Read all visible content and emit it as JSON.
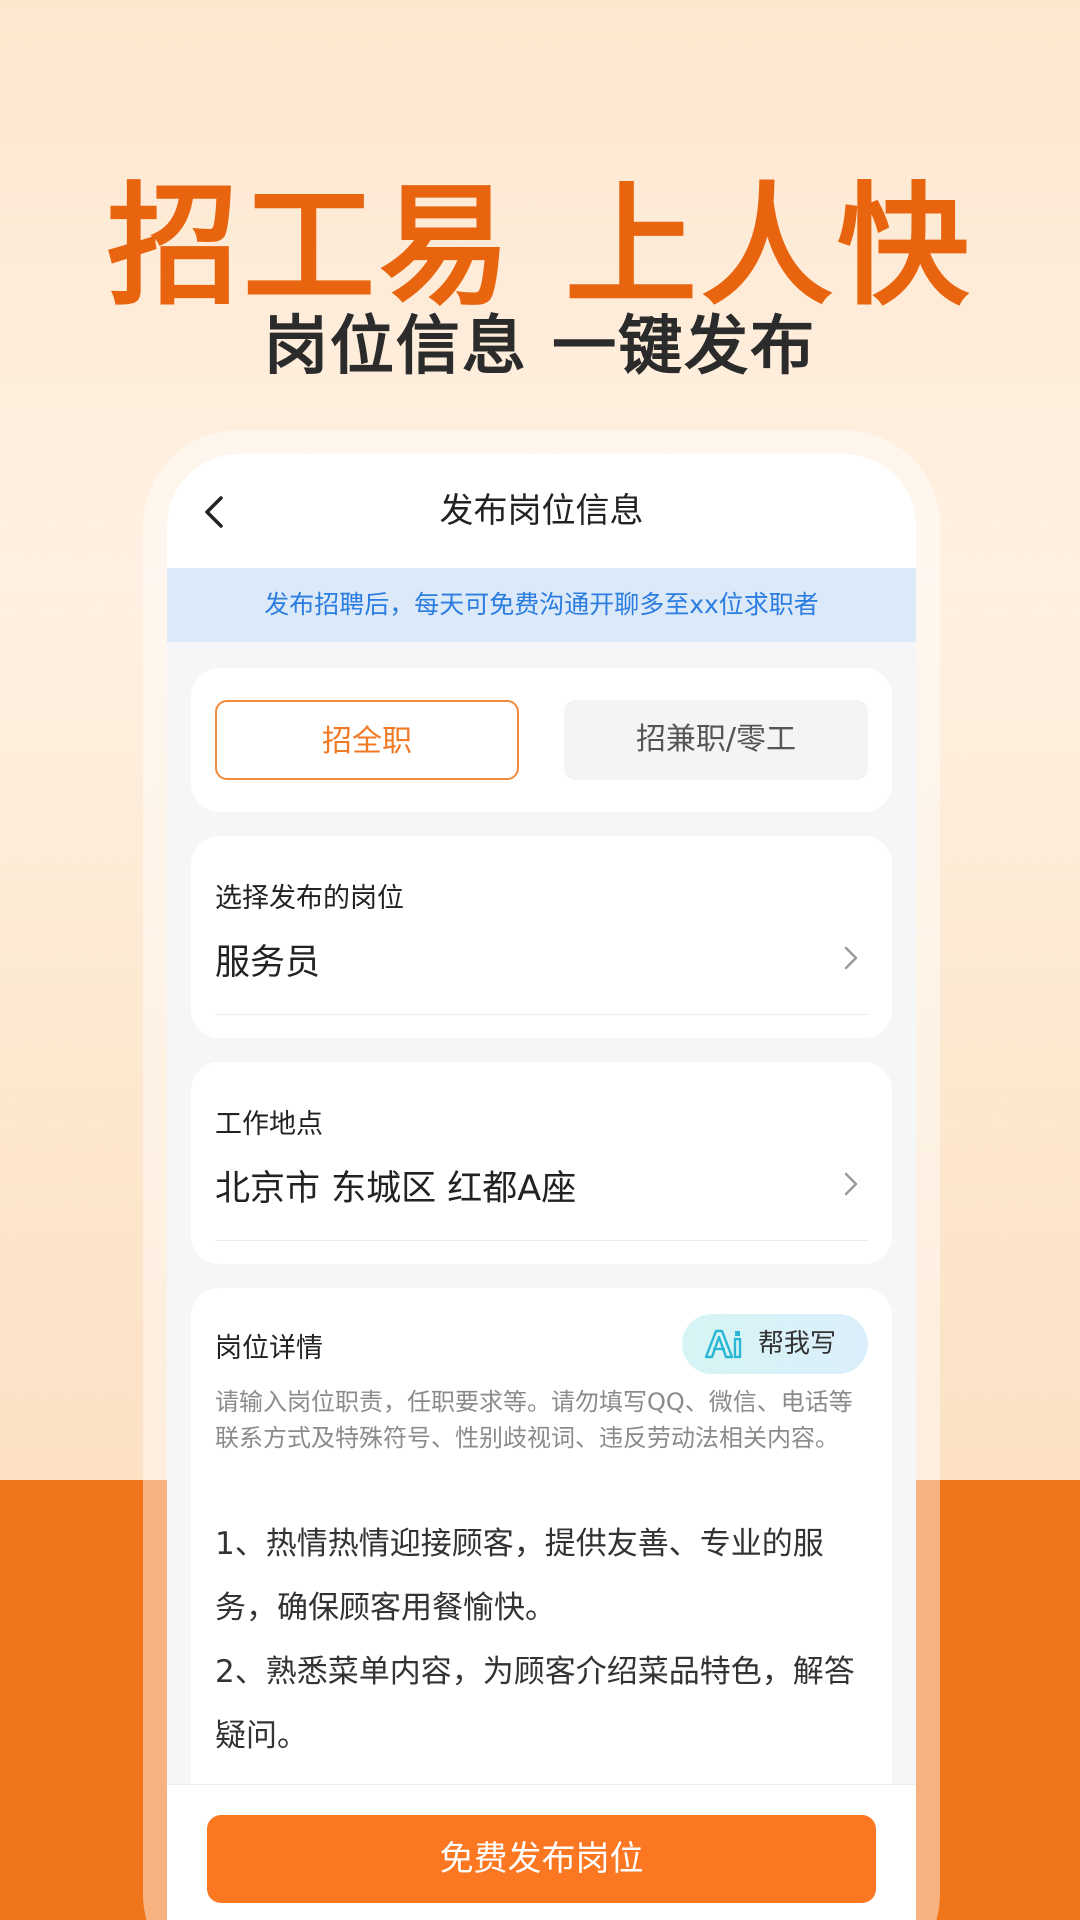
{
  "promo": {
    "headline": "招工易 上人快",
    "subheadline": "岗位信息 一键发布"
  },
  "nav": {
    "title": "发布岗位信息"
  },
  "notice": {
    "text": "发布招聘后，每天可免费沟通开聊多至xx位求职者"
  },
  "job_type": {
    "options": [
      {
        "label": "招全职",
        "selected": true
      },
      {
        "label": "招兼职/零工",
        "selected": false
      }
    ]
  },
  "position": {
    "label": "选择发布的岗位",
    "value": "服务员"
  },
  "location": {
    "label": "工作地点",
    "value": "北京市 东城区 红都A座"
  },
  "detail": {
    "label": "岗位详情",
    "ai_button_label": "帮我写",
    "hint": "请输入岗位职责，任职要求等。请勿填写QQ、微信、电话等联系方式及特殊符号、性别歧视词、违反劳动法相关内容。",
    "body_lines": [
      "1、热情热情迎接顾客，提供友善、专业的服务，确保顾客用餐愉快。",
      "2、熟悉菜单内容，为顾客介绍菜品特色，解答疑问。"
    ]
  },
  "footer": {
    "publish_label": "免费发布岗位"
  },
  "colors": {
    "accent": "#fb7722",
    "headline": "#e8640f",
    "notice_text": "#2b7de0",
    "notice_bg": "#dce9f8"
  }
}
